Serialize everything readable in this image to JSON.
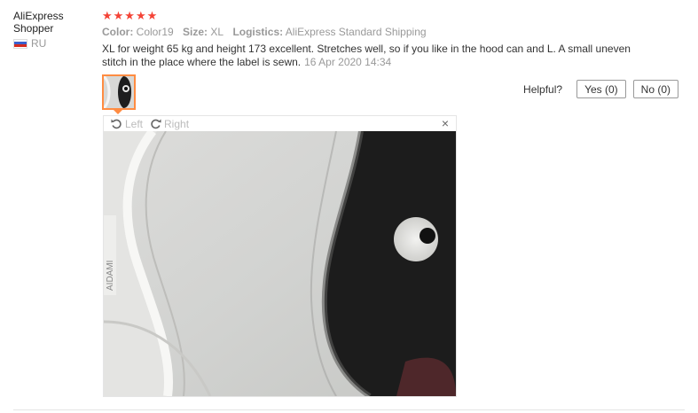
{
  "user": {
    "name": "AliExpress Shopper",
    "country": "RU"
  },
  "review": {
    "rating": 5,
    "stars": "★★★★★",
    "color_label": "Color:",
    "color_value": "Color19",
    "size_label": "Size:",
    "size_value": "XL",
    "logistics_label": "Logistics:",
    "logistics_value": "AliExpress Standard Shipping",
    "text": "XL for weight 65 kg and height 173 excellent. Stretches well, so if you like in the hood can and L. A small uneven stitch in the place where the label is sewn.",
    "date": "16 Apr 2020 14:34"
  },
  "helpful": {
    "label": "Helpful?",
    "yes_label": "Yes (0)",
    "no_label": "No (0)"
  },
  "viewer": {
    "rotate_left": "Left",
    "rotate_right": "Right",
    "close": "×",
    "label_text": "AIDAMI"
  },
  "colors": {
    "star": "#f44336",
    "thumb_border": "#ff8c42",
    "muted": "#999999"
  }
}
